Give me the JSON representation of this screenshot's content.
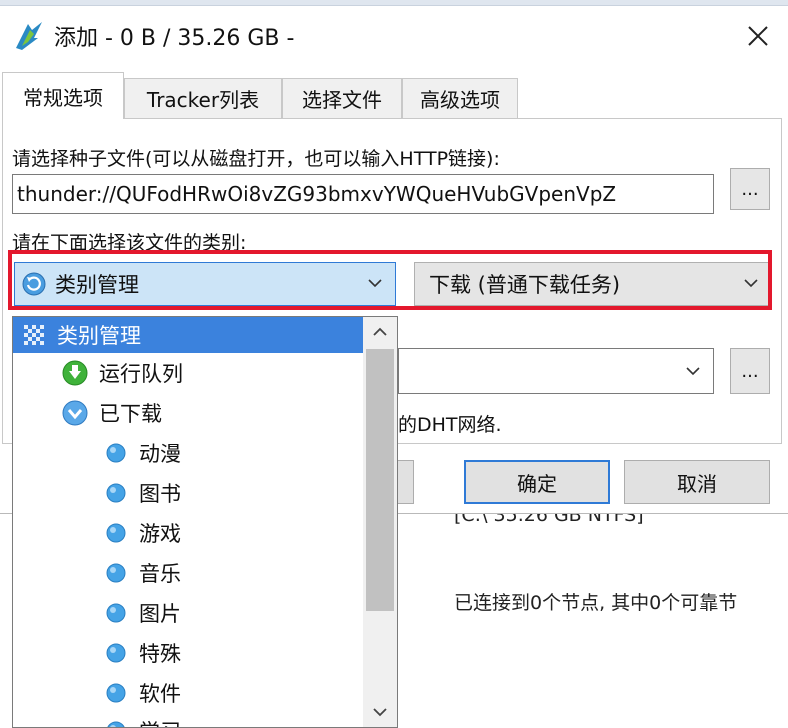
{
  "window": {
    "title": "添加 - 0 B / 35.26 GB -"
  },
  "tabs": [
    {
      "label": "常规选项"
    },
    {
      "label": "Tracker列表"
    },
    {
      "label": "选择文件"
    },
    {
      "label": "高级选项"
    }
  ],
  "general": {
    "torrent_label": "请选择种子文件(可以从磁盘打开，也可以输入HTTP链接):",
    "torrent_value": "thunder://QUFodHRwOi8vZG93bmxvYWQueHVubGVpenVpZ",
    "browse_label": "...",
    "category_label": "请在下面选择该文件的类别:",
    "category_selected": "类别管理",
    "task_type_selected": "下载 (普通下载任务)",
    "save_dir_browse_label": "...",
    "dht_note_fragment": "的DHT网络."
  },
  "buttons": {
    "ok": "确定",
    "cancel": "取消"
  },
  "category_list": [
    {
      "label": "类别管理",
      "level": 0,
      "icon": "category-root-icon",
      "selected": true
    },
    {
      "label": "运行队列",
      "level": 1,
      "icon": "green-download-icon"
    },
    {
      "label": "已下载",
      "level": 1,
      "icon": "blue-download-icon"
    },
    {
      "label": "动漫",
      "level": 2,
      "icon": "blue-dot-icon"
    },
    {
      "label": "图书",
      "level": 2,
      "icon": "blue-dot-icon"
    },
    {
      "label": "游戏",
      "level": 2,
      "icon": "blue-dot-icon"
    },
    {
      "label": "音乐",
      "level": 2,
      "icon": "blue-dot-icon"
    },
    {
      "label": "图片",
      "level": 2,
      "icon": "blue-dot-icon"
    },
    {
      "label": "特殊",
      "level": 2,
      "icon": "blue-dot-icon"
    },
    {
      "label": "软件",
      "level": 2,
      "icon": "blue-dot-icon"
    },
    {
      "label": "学习",
      "level": 2,
      "icon": "blue-dot-icon"
    }
  ],
  "background": {
    "disk_info": "[C:\\ 35.26 GB  NTFS]",
    "peers_info": "已连接到0个节点, 其中0个可靠节"
  },
  "colors": {
    "accent": "#2f7ad6",
    "selection": "#3b82dd",
    "highlight_frame": "#e3182d"
  }
}
